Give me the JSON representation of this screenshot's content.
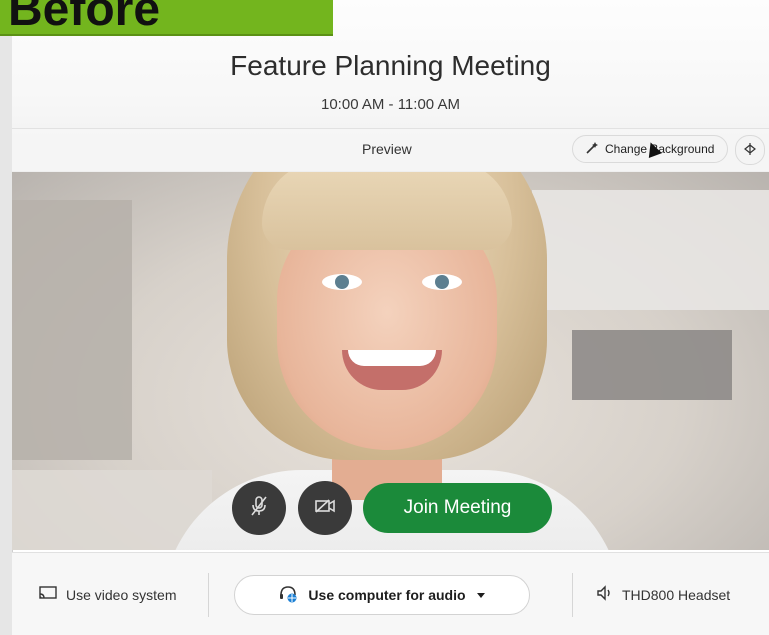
{
  "banner": {
    "text": "Before"
  },
  "meeting": {
    "title": "Feature Planning Meeting",
    "time": "10:00 AM - 11:00 AM"
  },
  "preview": {
    "label": "Preview",
    "change_background_label": "Change Background",
    "icons": {
      "change_background": "magic-wand-icon",
      "more": "more-options-icon"
    }
  },
  "controls": {
    "join_label": "Join Meeting",
    "join_color": "#1b8a3a",
    "icons": {
      "mute": "microphone-muted-icon",
      "video": "camera-off-icon"
    }
  },
  "bottom": {
    "video_system_label": "Use video system",
    "audio_label": "Use computer for audio",
    "headset_label": "THD800 Headset",
    "icons": {
      "video_system": "screen-cast-icon",
      "audio": "headset-globe-icon",
      "audio_dropdown": "caret-down-icon",
      "headset": "speaker-icon"
    }
  },
  "colors": {
    "banner": "#73b51e",
    "join_button": "#1b8a3a"
  }
}
